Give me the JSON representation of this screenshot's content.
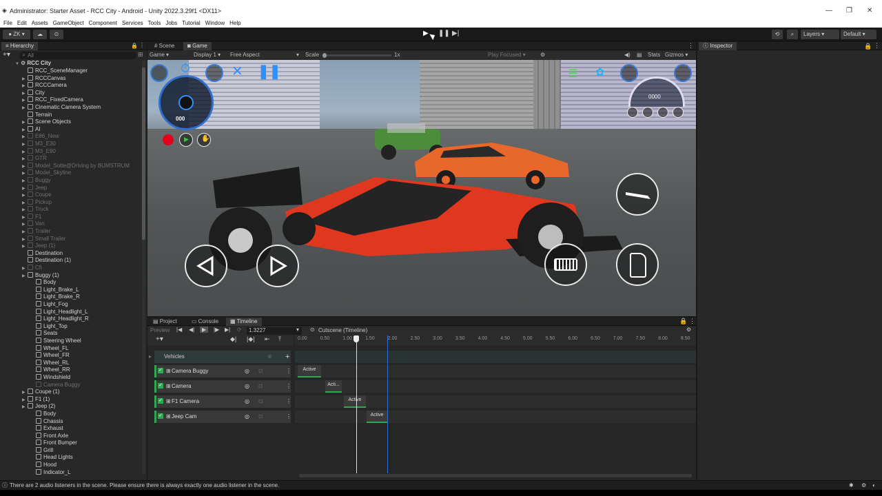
{
  "window": {
    "title": "Administrator: Starter Asset - RCC City - Android - Unity 2022.3.29f1 <DX11>"
  },
  "menu": [
    "File",
    "Edit",
    "Assets",
    "GameObject",
    "Component",
    "Services",
    "Tools",
    "Jobs",
    "Tutorial",
    "Window",
    "Help"
  ],
  "toolbar": {
    "account": "ZK",
    "layers": "Layers",
    "layout": "Default"
  },
  "hierarchy": {
    "tab": "Hierarchy",
    "search_placeholder": "All",
    "root": "RCC City",
    "items": [
      {
        "label": "RCC_SceneManager",
        "level": 1,
        "dim": false,
        "arrow": false
      },
      {
        "label": "RCCCanvas",
        "level": 1,
        "dim": false,
        "arrow": true
      },
      {
        "label": "RCCCamera",
        "level": 1,
        "dim": false,
        "arrow": true
      },
      {
        "label": "City",
        "level": 1,
        "dim": false,
        "arrow": true
      },
      {
        "label": "RCC_FixedCamera",
        "level": 1,
        "dim": false,
        "arrow": true
      },
      {
        "label": "Cinematic Camera System",
        "level": 1,
        "dim": false,
        "arrow": true
      },
      {
        "label": "Terrain",
        "level": 1,
        "dim": false,
        "arrow": false
      },
      {
        "label": "Scene Objects",
        "level": 1,
        "dim": false,
        "arrow": true
      },
      {
        "label": "AI",
        "level": 1,
        "dim": false,
        "arrow": true
      },
      {
        "label": "E86_New",
        "level": 1,
        "dim": true,
        "arrow": true
      },
      {
        "label": "M3_E30",
        "level": 1,
        "dim": true,
        "arrow": true
      },
      {
        "label": "M3_E90",
        "level": 1,
        "dim": true,
        "arrow": true
      },
      {
        "label": "GTR",
        "level": 1,
        "dim": true,
        "arrow": true
      },
      {
        "label": "Model_Sotte@Driving by BUMSTRUM",
        "level": 1,
        "dim": true,
        "arrow": true
      },
      {
        "label": "Model_Skyline",
        "level": 1,
        "dim": true,
        "arrow": true
      },
      {
        "label": "Buggy",
        "level": 1,
        "dim": true,
        "arrow": true
      },
      {
        "label": "Jeep",
        "level": 1,
        "dim": true,
        "arrow": true
      },
      {
        "label": "Coupe",
        "level": 1,
        "dim": true,
        "arrow": true
      },
      {
        "label": "Pickup",
        "level": 1,
        "dim": true,
        "arrow": true
      },
      {
        "label": "Truck",
        "level": 1,
        "dim": true,
        "arrow": true
      },
      {
        "label": "F1",
        "level": 1,
        "dim": true,
        "arrow": true
      },
      {
        "label": "Van",
        "level": 1,
        "dim": true,
        "arrow": true
      },
      {
        "label": "Trailer",
        "level": 1,
        "dim": true,
        "arrow": true
      },
      {
        "label": "Small Trailer",
        "level": 1,
        "dim": true,
        "arrow": true
      },
      {
        "label": "Jeep (1)",
        "level": 1,
        "dim": true,
        "arrow": true
      },
      {
        "label": "Destination",
        "level": 1,
        "dim": false,
        "arrow": false
      },
      {
        "label": "Destination (1)",
        "level": 1,
        "dim": false,
        "arrow": false
      },
      {
        "label": "Cfi",
        "level": 1,
        "dim": true,
        "arrow": true
      },
      {
        "label": "Buggy (1)",
        "level": 1,
        "dim": false,
        "arrow": true
      },
      {
        "label": "Body",
        "level": 2,
        "dim": false,
        "arrow": false
      },
      {
        "label": "Light_Brake_L",
        "level": 2,
        "dim": false,
        "arrow": false
      },
      {
        "label": "Light_Brake_R",
        "level": 2,
        "dim": false,
        "arrow": false
      },
      {
        "label": "Light_Fog",
        "level": 2,
        "dim": false,
        "arrow": false
      },
      {
        "label": "Light_Headlight_L",
        "level": 2,
        "dim": false,
        "arrow": false
      },
      {
        "label": "Light_Headlight_R",
        "level": 2,
        "dim": false,
        "arrow": false
      },
      {
        "label": "Light_Top",
        "level": 2,
        "dim": false,
        "arrow": false
      },
      {
        "label": "Seats",
        "level": 2,
        "dim": false,
        "arrow": false
      },
      {
        "label": "Steering Wheel",
        "level": 2,
        "dim": false,
        "arrow": false
      },
      {
        "label": "Wheel_FL",
        "level": 2,
        "dim": false,
        "arrow": false
      },
      {
        "label": "Wheel_FR",
        "level": 2,
        "dim": false,
        "arrow": false
      },
      {
        "label": "Wheel_RL",
        "level": 2,
        "dim": false,
        "arrow": false
      },
      {
        "label": "Wheel_RR",
        "level": 2,
        "dim": false,
        "arrow": false
      },
      {
        "label": "Windshield",
        "level": 2,
        "dim": false,
        "arrow": false
      },
      {
        "label": "Camera Buggy",
        "level": 2,
        "dim": true,
        "arrow": false
      },
      {
        "label": "Coupe (1)",
        "level": 1,
        "dim": false,
        "arrow": true
      },
      {
        "label": "F1 (1)",
        "level": 1,
        "dim": false,
        "arrow": true
      },
      {
        "label": "Jeep (2)",
        "level": 1,
        "dim": false,
        "arrow": true
      },
      {
        "label": "Body",
        "level": 2,
        "dim": false,
        "arrow": false
      },
      {
        "label": "Chassis",
        "level": 2,
        "dim": false,
        "arrow": false
      },
      {
        "label": "Exhaust",
        "level": 2,
        "dim": false,
        "arrow": false
      },
      {
        "label": "Front Axle",
        "level": 2,
        "dim": false,
        "arrow": false
      },
      {
        "label": "Front Bumper",
        "level": 2,
        "dim": false,
        "arrow": false
      },
      {
        "label": "Grill",
        "level": 2,
        "dim": false,
        "arrow": false
      },
      {
        "label": "Head Lights",
        "level": 2,
        "dim": false,
        "arrow": false
      },
      {
        "label": "Hood",
        "level": 2,
        "dim": false,
        "arrow": false
      },
      {
        "label": "Indicator_L",
        "level": 2,
        "dim": false,
        "arrow": false
      }
    ]
  },
  "game": {
    "tab_scene": "Scene",
    "tab_game": "Game",
    "display_mode": "Game",
    "display": "Display 1",
    "aspect": "Free Aspect",
    "scale_label": "Scale",
    "scale_value": "1x",
    "play_mode": "Play Focused",
    "stats": "Stats",
    "gizmos": "Gizmos"
  },
  "timeline": {
    "tab_project": "Project",
    "tab_console": "Console",
    "tab_timeline": "Timeline",
    "preview": "Preview",
    "time": "1.3227",
    "asset": "Cutscene (Timeline)",
    "group": "Vehicles",
    "ticks": [
      "0.00",
      "0.50",
      "1.00",
      "1.50",
      "2.00",
      "2.50",
      "3.00",
      "3.50",
      "4.00",
      "4.50",
      "5.00",
      "5.50",
      "6.00",
      "6.50",
      "7.00",
      "7.50",
      "8.00",
      "8.50"
    ],
    "tracks": [
      {
        "label": "Camera Buggy",
        "clip": "Active"
      },
      {
        "label": "Camera",
        "clip": "Acti..."
      },
      {
        "label": "F1 Camera",
        "clip": "Active"
      },
      {
        "label": "Jeep Cam",
        "clip": "Active"
      }
    ]
  },
  "inspector": {
    "tab": "Inspector"
  },
  "status": {
    "message": "There are 2 audio listeners in the scene. Please ensure there is always exactly one audio listener in the scene."
  },
  "hud": {
    "speed_readout": "000",
    "rpm_readout": "0000"
  }
}
